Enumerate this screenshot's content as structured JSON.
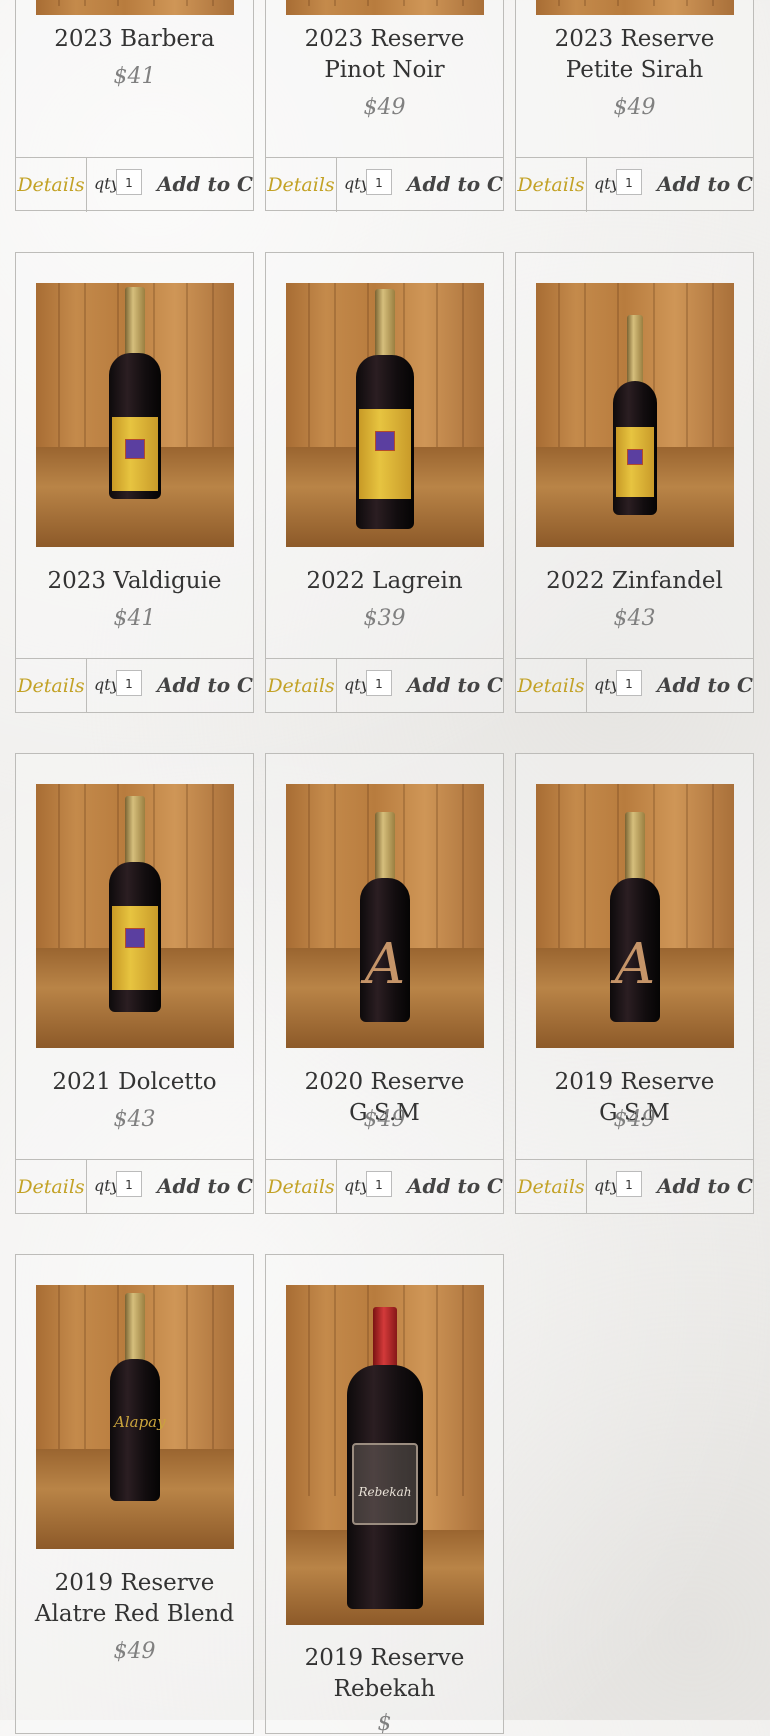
{
  "actions": {
    "details_label": "Details",
    "qty_label": "qty",
    "qty_value": "1",
    "add_to_cart_label": "Add to Cart"
  },
  "products": [
    {
      "name": "2023 Barbera",
      "price": "$41"
    },
    {
      "name": "2023 Reserve Pinot Noir",
      "price": "$49"
    },
    {
      "name": "2023 Reserve Petite Sirah",
      "price": "$49"
    },
    {
      "name": "2023 Valdiguie",
      "price": "$41",
      "bottle": "yellow-label"
    },
    {
      "name": "2022 Lagrein",
      "price": "$39",
      "bottle": "yellow-label"
    },
    {
      "name": "2022 Zinfandel",
      "price": "$43",
      "bottle": "yellow-label"
    },
    {
      "name": "2021 Dolcetto",
      "price": "$43",
      "bottle": "yellow-label"
    },
    {
      "name": "2020 Reserve G.S.M",
      "price": "$49",
      "bottle": "etched-A"
    },
    {
      "name": "2019 Reserve G.S.M",
      "price": "$49",
      "bottle": "etched-A"
    },
    {
      "name": "2019 Reserve Alatre Red Blend",
      "price": "$49",
      "bottle": "gold-print"
    },
    {
      "name": "2019 Reserve Rebekah",
      "price": "$",
      "bottle": "red-capsule-embossed"
    }
  ],
  "bottle_labels": {
    "brand": "Alapay",
    "etched_letter": "A",
    "rebekah_script": "Rebekah"
  },
  "colors": {
    "details_gold": "#c3a226",
    "price_gray": "#808080",
    "name_dark": "#333333",
    "border": "#bdbcb9"
  }
}
